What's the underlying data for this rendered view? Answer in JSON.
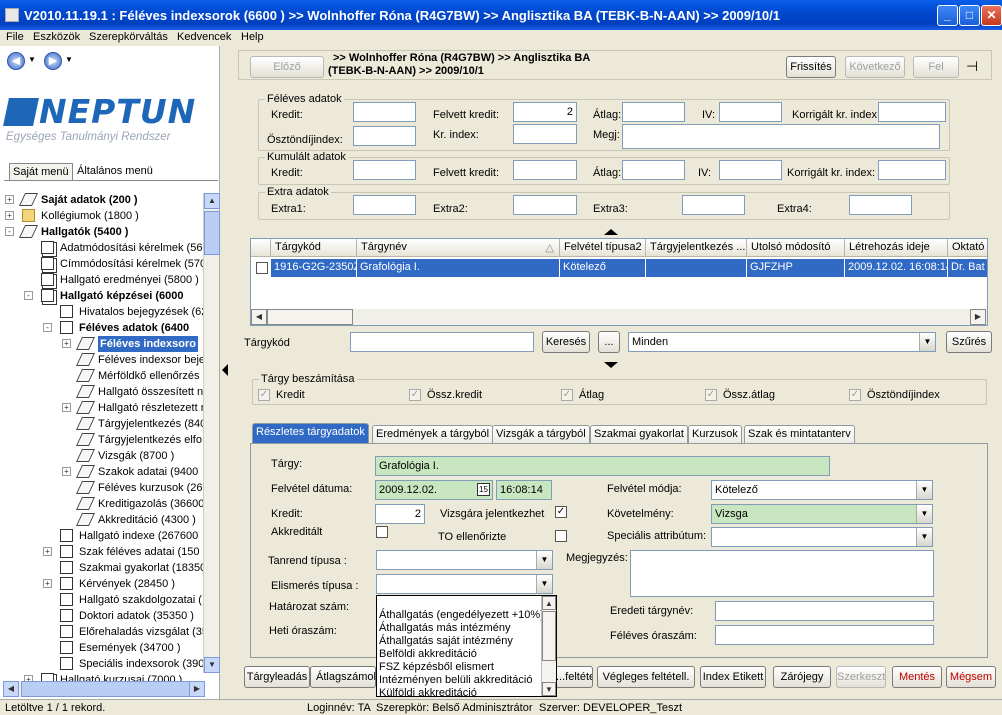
{
  "window": {
    "title": "V2010.11.19.1 : Féléves indexsorok (6600  )  >> Wolnhoffer Róna (R4G7BW) >> Anglisztika BA (TEBK-B-N-AAN) >> 2009/10/1",
    "minimize": "_",
    "maximize": "□",
    "close": "✕"
  },
  "menu": [
    "File",
    "Eszközök",
    "Szerepkörváltás",
    "Kedvencek",
    "Help"
  ],
  "logo": {
    "word": "NEPTUN",
    "subtitle": "Egységes Tanulmányi Rendszer"
  },
  "left_tabs": [
    "Saját menü",
    "Általános menü"
  ],
  "tree": [
    {
      "label": "Saját adatok (200  )",
      "bold": true,
      "indent": 0,
      "toggle": "+",
      "icon": "tag"
    },
    {
      "label": "Kollégiumok (1800  )",
      "bold": false,
      "indent": 0,
      "toggle": "+",
      "icon": "folder"
    },
    {
      "label": "Hallgatók (5400  )",
      "bold": true,
      "indent": 0,
      "toggle": "-",
      "icon": "tag"
    },
    {
      "label": "Adatmódosítási kérelmek (560",
      "bold": false,
      "indent": 1,
      "toggle": "",
      "icon": "multi"
    },
    {
      "label": "Címmódosítási kérelmek (570",
      "bold": false,
      "indent": 1,
      "toggle": "",
      "icon": "multi"
    },
    {
      "label": "Hallgató eredményei (5800  )",
      "bold": false,
      "indent": 1,
      "toggle": "",
      "icon": "multi"
    },
    {
      "label": "Hallgató képzései (6000",
      "bold": true,
      "indent": 1,
      "toggle": "-",
      "icon": "multi"
    },
    {
      "label": "Hivatalos bejegyzések (62",
      "bold": false,
      "indent": 2,
      "toggle": "",
      "icon": "doc"
    },
    {
      "label": "Féléves adatok (6400",
      "bold": true,
      "indent": 2,
      "toggle": "-",
      "icon": "doc"
    },
    {
      "label": "Féléves indexsoro",
      "bold": true,
      "indent": 3,
      "toggle": "+",
      "icon": "tag",
      "selected": true
    },
    {
      "label": "Féléves indexsor beje",
      "bold": false,
      "indent": 3,
      "toggle": "",
      "icon": "tag"
    },
    {
      "label": "Mérföldkő ellenőrzés",
      "bold": false,
      "indent": 3,
      "toggle": "",
      "icon": "tag"
    },
    {
      "label": "Hallgató összesített n",
      "bold": false,
      "indent": 3,
      "toggle": "",
      "icon": "tag"
    },
    {
      "label": "Hallgató részletezett n",
      "bold": false,
      "indent": 3,
      "toggle": "+",
      "icon": "tag"
    },
    {
      "label": "Tárgyjelentkezés (840",
      "bold": false,
      "indent": 3,
      "toggle": "",
      "icon": "tag"
    },
    {
      "label": "Tárgyjelentkezés elfo",
      "bold": false,
      "indent": 3,
      "toggle": "",
      "icon": "tag"
    },
    {
      "label": "Vizsgák (8700  )",
      "bold": false,
      "indent": 3,
      "toggle": "",
      "icon": "tag"
    },
    {
      "label": "Szakok adatai (9400",
      "bold": false,
      "indent": 3,
      "toggle": "+",
      "icon": "tag"
    },
    {
      "label": "Féléves kurzusok (26",
      "bold": false,
      "indent": 3,
      "toggle": "",
      "icon": "tag"
    },
    {
      "label": "Kreditigazolás (36600",
      "bold": false,
      "indent": 3,
      "toggle": "",
      "icon": "tag"
    },
    {
      "label": "Akkreditáció (4300  )",
      "bold": false,
      "indent": 3,
      "toggle": "",
      "icon": "tag"
    },
    {
      "label": "Hallgató indexe (267600",
      "bold": false,
      "indent": 2,
      "toggle": "",
      "icon": "doc"
    },
    {
      "label": "Szak féléves adatai (150",
      "bold": false,
      "indent": 2,
      "toggle": "+",
      "icon": "doc"
    },
    {
      "label": "Szakmai gyakorlat (18350",
      "bold": false,
      "indent": 2,
      "toggle": "",
      "icon": "doc"
    },
    {
      "label": "Kérvények (28450  )",
      "bold": false,
      "indent": 2,
      "toggle": "+",
      "icon": "doc"
    },
    {
      "label": "Hallgató szakdolgozatai (",
      "bold": false,
      "indent": 2,
      "toggle": "",
      "icon": "doc"
    },
    {
      "label": "Doktori adatok (35350  )",
      "bold": false,
      "indent": 2,
      "toggle": "",
      "icon": "doc"
    },
    {
      "label": "Előrehaladás vizsgálat (35",
      "bold": false,
      "indent": 2,
      "toggle": "",
      "icon": "doc"
    },
    {
      "label": "Események (34700  )",
      "bold": false,
      "indent": 2,
      "toggle": "",
      "icon": "doc"
    },
    {
      "label": "Speciális indexsorok (390",
      "bold": false,
      "indent": 2,
      "toggle": "",
      "icon": "doc"
    },
    {
      "label": "Hallgató kurzusai (7000  )",
      "bold": false,
      "indent": 1,
      "toggle": "+",
      "icon": "multi"
    }
  ],
  "header": {
    "prev": "Előző",
    "breadcrumb_line1": ">> Wolnhoffer Róna (R4G7BW) >> Anglisztika BA",
    "breadcrumb_line2": "(TEBK-B-N-AAN) >> 2009/10/1",
    "refresh": "Frissítés",
    "next": "Következő",
    "up": "Fel",
    "pin": "⊣"
  },
  "semester_group": {
    "caption": "Féléves adatok",
    "kredit_label": "Kredit:",
    "felvett_label": "Felvett kredit:",
    "felvett_value": "2",
    "atlag_label": "Átlag:",
    "iv_label": "IV:",
    "korr_label": "Korrigált kr. index:",
    "osztondij_label": "Ösztöndíjindex:",
    "krindex_label": "Kr. index:",
    "megj_label": "Megj:"
  },
  "cumulative_group": {
    "caption": "Kumulált adatok",
    "kredit_label": "Kredit:",
    "felvett_label": "Felvett kredit:",
    "atlag_label": "Átlag:",
    "iv_label": "IV:",
    "korr_label": "Korrigált kr. index:"
  },
  "extra_group": {
    "caption": "Extra adatok",
    "labels": [
      "Extra1:",
      "Extra2:",
      "Extra3:",
      "Extra4:"
    ]
  },
  "grid": {
    "columns": [
      "Tárgykód",
      "Tárgynév",
      "Felvétel típusa2",
      "Tárgyjelentkezés ...",
      "Utolsó módosító",
      "Létrehozás ideje",
      "Oktató"
    ],
    "sort_indicator": "△",
    "rows": [
      [
        "1916-G2G-2350Z",
        "Grafológia I.",
        "Kötelező",
        "",
        "GJFZHP",
        "2009.12.02. 16:08:14",
        "Dr. Bat"
      ]
    ]
  },
  "search": {
    "label": "Tárgykód",
    "value": "",
    "search_button": "Keresés",
    "dots_button": "...",
    "filter_value": "Minden",
    "filter_button": "Szűrés"
  },
  "credit_group": {
    "caption": "Tárgy beszámítása",
    "items": [
      {
        "label": "Kredit",
        "checked": true
      },
      {
        "label": "Össz.kredit",
        "checked": true
      },
      {
        "label": "Átlag",
        "checked": true
      },
      {
        "label": "Össz.átlag",
        "checked": true
      },
      {
        "label": "Ösztöndíjindex",
        "checked": true
      }
    ]
  },
  "tabs": [
    "Részletes tárgyadatok",
    "Eredmények a tárgyból",
    "Vizsgák a tárgyból",
    "Szakmai gyakorlat",
    "Kurzusok",
    "Szak és mintatanterv"
  ],
  "active_tab": 0,
  "details": {
    "targy_label": "Tárgy:",
    "targy_value": "Grafológia I.",
    "felvetel_datum_label": "Felvétel dátuma:",
    "felvetel_date": "2009.12.02.",
    "felvetel_time": "16:08:14",
    "calendar_icon": "15",
    "felvetel_modja_label": "Felvétel módja:",
    "felvetel_modja_value": "Kötelező",
    "kredit_label": "Kredit:",
    "kredit_value": "2",
    "vizsgara_label": "Vizsgára jelentkezhet",
    "vizsgara_checked": true,
    "kovetelmeny_label": "Követelmény:",
    "kovetelmeny_value": "Vizsga",
    "akkreditalt_label": "Akkreditált",
    "to_label": "TO ellenőrizte",
    "specialis_label": "Speciális attribútum:",
    "specialis_value": "",
    "tanrend_label": "Tanrend típusa :",
    "megjegyzes_label": "Megjegyzés:",
    "elismeres_label": "Elismerés típusa :",
    "hatarozat_label": "Határozat szám:",
    "heti_label": "Heti óraszám:",
    "eredeti_label": "Eredeti tárgynév:",
    "feleves_label": "Féléves óraszám:"
  },
  "dropdown_options": [
    "Áthallgatás (engedélyezett +10%)",
    "Áthallgatás más intézmény",
    "Áthallgatás saját intézmény",
    "Belföldi akkreditáció",
    "FSZ képzésből elismert",
    "Intézményen belüli akkreditáció",
    "Külföldi akkreditáció"
  ],
  "bottom_buttons": [
    {
      "label": "Tárgyleadás",
      "state": "normal"
    },
    {
      "label": "Átlagszámolás",
      "state": "normal"
    },
    {
      "label": "...feltétell.",
      "state": "normal"
    },
    {
      "label": "Végleges feltétell.",
      "state": "normal"
    },
    {
      "label": "Index Etikett",
      "state": "normal"
    },
    {
      "label": "Zárójegy",
      "state": "normal"
    },
    {
      "label": "Szerkeszt",
      "state": "disabled"
    },
    {
      "label": "Mentés",
      "state": "red"
    },
    {
      "label": "Mégsem",
      "state": "red"
    }
  ],
  "statusbar": {
    "records": "Letöltve 1 / 1 rekord.",
    "login": "Loginnév: TA",
    "role": "Szerepkör: Belső Adminisztrátor",
    "server": "Szerver: DEVELOPER_Teszt"
  }
}
